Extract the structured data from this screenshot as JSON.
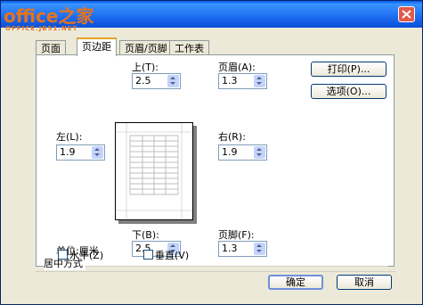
{
  "watermark": {
    "main": "office之家",
    "sub": "OFFICE.JB51.NET"
  },
  "tabs": [
    {
      "label": "页面"
    },
    {
      "label": "页边距"
    },
    {
      "label": "页眉/页脚"
    },
    {
      "label": "工作表"
    }
  ],
  "margins": {
    "top": {
      "label": "上(T):",
      "value": "2.5"
    },
    "header": {
      "label": "页眉(A):",
      "value": "1.3"
    },
    "left": {
      "label": "左(L):",
      "value": "1.9"
    },
    "right": {
      "label": "右(R):",
      "value": "1.9"
    },
    "bottom": {
      "label": "下(B):",
      "value": "2.5"
    },
    "footer": {
      "label": "页脚(F):",
      "value": "1.3"
    }
  },
  "unit_label": "单位:厘米",
  "center_group": {
    "title": "居中方式",
    "horizontal": {
      "label": "水平(Z)",
      "checked": false
    },
    "vertical": {
      "label": "垂直(V)",
      "checked": false
    }
  },
  "buttons": {
    "print": "打印(P)...",
    "options": "选项(O)...",
    "ok": "确定",
    "cancel": "取消"
  },
  "colors": {
    "title_bar": "#1d6cf0",
    "watermark": "#e5731e",
    "close_button": "#e2594a"
  }
}
